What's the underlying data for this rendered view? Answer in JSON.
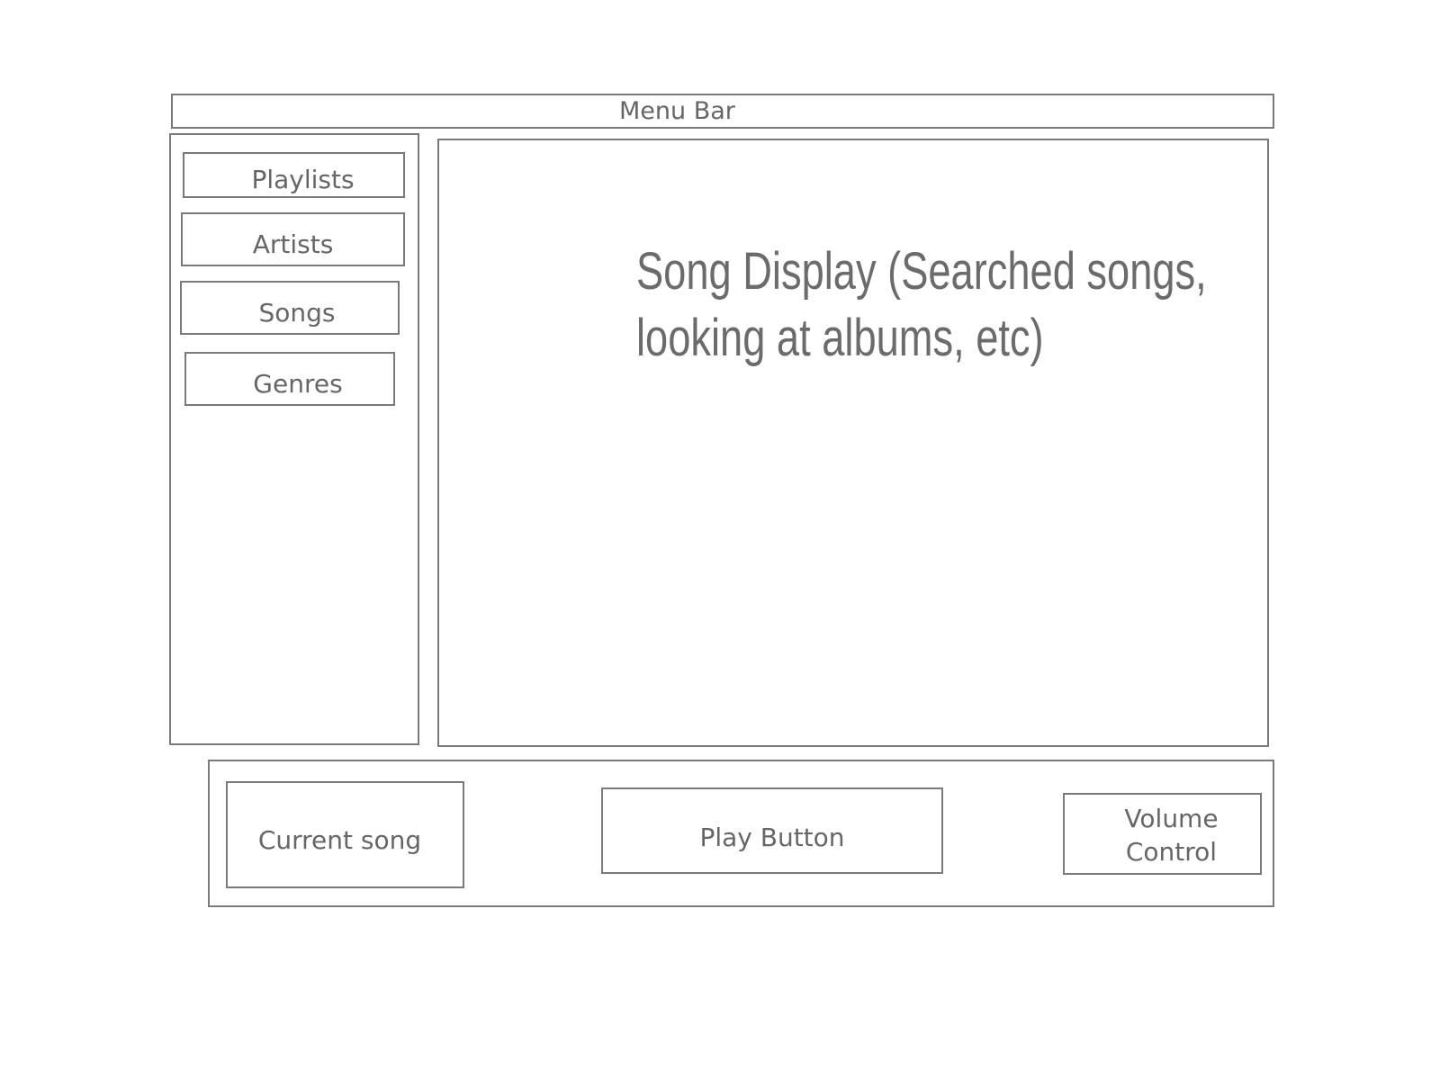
{
  "menu_bar": {
    "label": "Menu Bar"
  },
  "sidebar": {
    "items": [
      {
        "label": "Playlists"
      },
      {
        "label": "Artists"
      },
      {
        "label": "Songs"
      },
      {
        "label": "Genres"
      }
    ]
  },
  "main": {
    "line1": "Song Display (Searched songs,",
    "line2": "looking at albums, etc)"
  },
  "footer": {
    "current_song": "Current song",
    "play_button": "Play Button",
    "volume_line1": "Volume",
    "volume_line2": "Control"
  }
}
